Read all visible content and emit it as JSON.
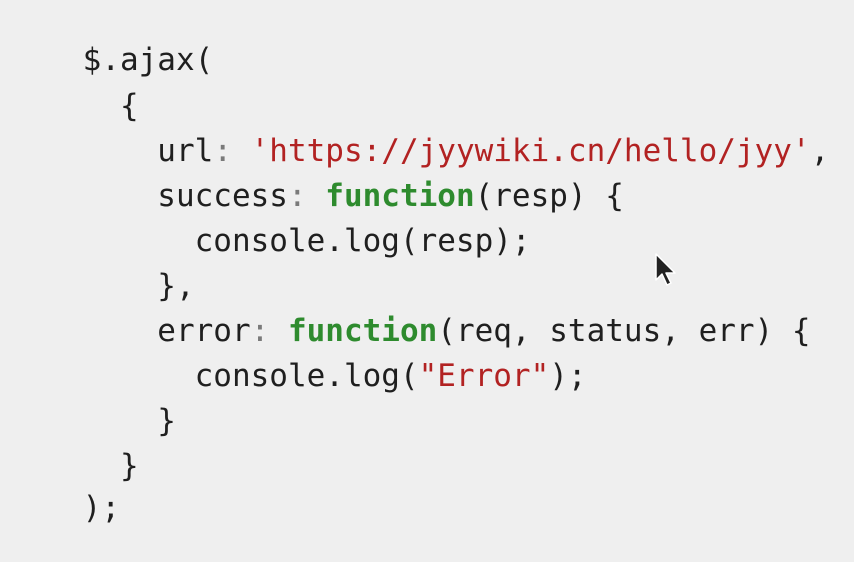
{
  "code_lines": [
    {
      "parts": [
        {
          "t": "$.ajax(",
          "c": "punct"
        }
      ]
    },
    {
      "parts": [
        {
          "t": "  {",
          "c": "punct"
        }
      ]
    },
    {
      "parts": [
        {
          "t": "    url",
          "c": "punct"
        },
        {
          "t": ": ",
          "c": "colon"
        },
        {
          "t": "'https://jyywiki.cn/hello/jyy'",
          "c": "str"
        },
        {
          "t": ",",
          "c": "punct"
        }
      ]
    },
    {
      "parts": [
        {
          "t": "    success",
          "c": "punct"
        },
        {
          "t": ": ",
          "c": "colon"
        },
        {
          "t": "function",
          "c": "kw"
        },
        {
          "t": "(resp) {",
          "c": "punct"
        }
      ]
    },
    {
      "parts": [
        {
          "t": "      console.log(resp);",
          "c": "punct"
        }
      ]
    },
    {
      "parts": [
        {
          "t": "    },",
          "c": "punct"
        }
      ]
    },
    {
      "parts": [
        {
          "t": "    error",
          "c": "punct"
        },
        {
          "t": ": ",
          "c": "colon"
        },
        {
          "t": "function",
          "c": "kw"
        },
        {
          "t": "(req, status, err) {",
          "c": "punct"
        }
      ]
    },
    {
      "parts": [
        {
          "t": "      console.log(",
          "c": "punct"
        },
        {
          "t": "\"Error\"",
          "c": "str"
        },
        {
          "t": ");",
          "c": "punct"
        }
      ]
    },
    {
      "parts": [
        {
          "t": "    }",
          "c": "punct"
        }
      ]
    },
    {
      "parts": [
        {
          "t": "  }",
          "c": "punct"
        }
      ]
    },
    {
      "parts": [
        {
          "t": ");",
          "c": "punct"
        }
      ]
    }
  ],
  "colors": {
    "background": "#efefef",
    "keyword": "#2e8b2e",
    "string": "#b22222",
    "text": "#1f1f1f"
  },
  "cursor_icon": "mouse-pointer-icon"
}
